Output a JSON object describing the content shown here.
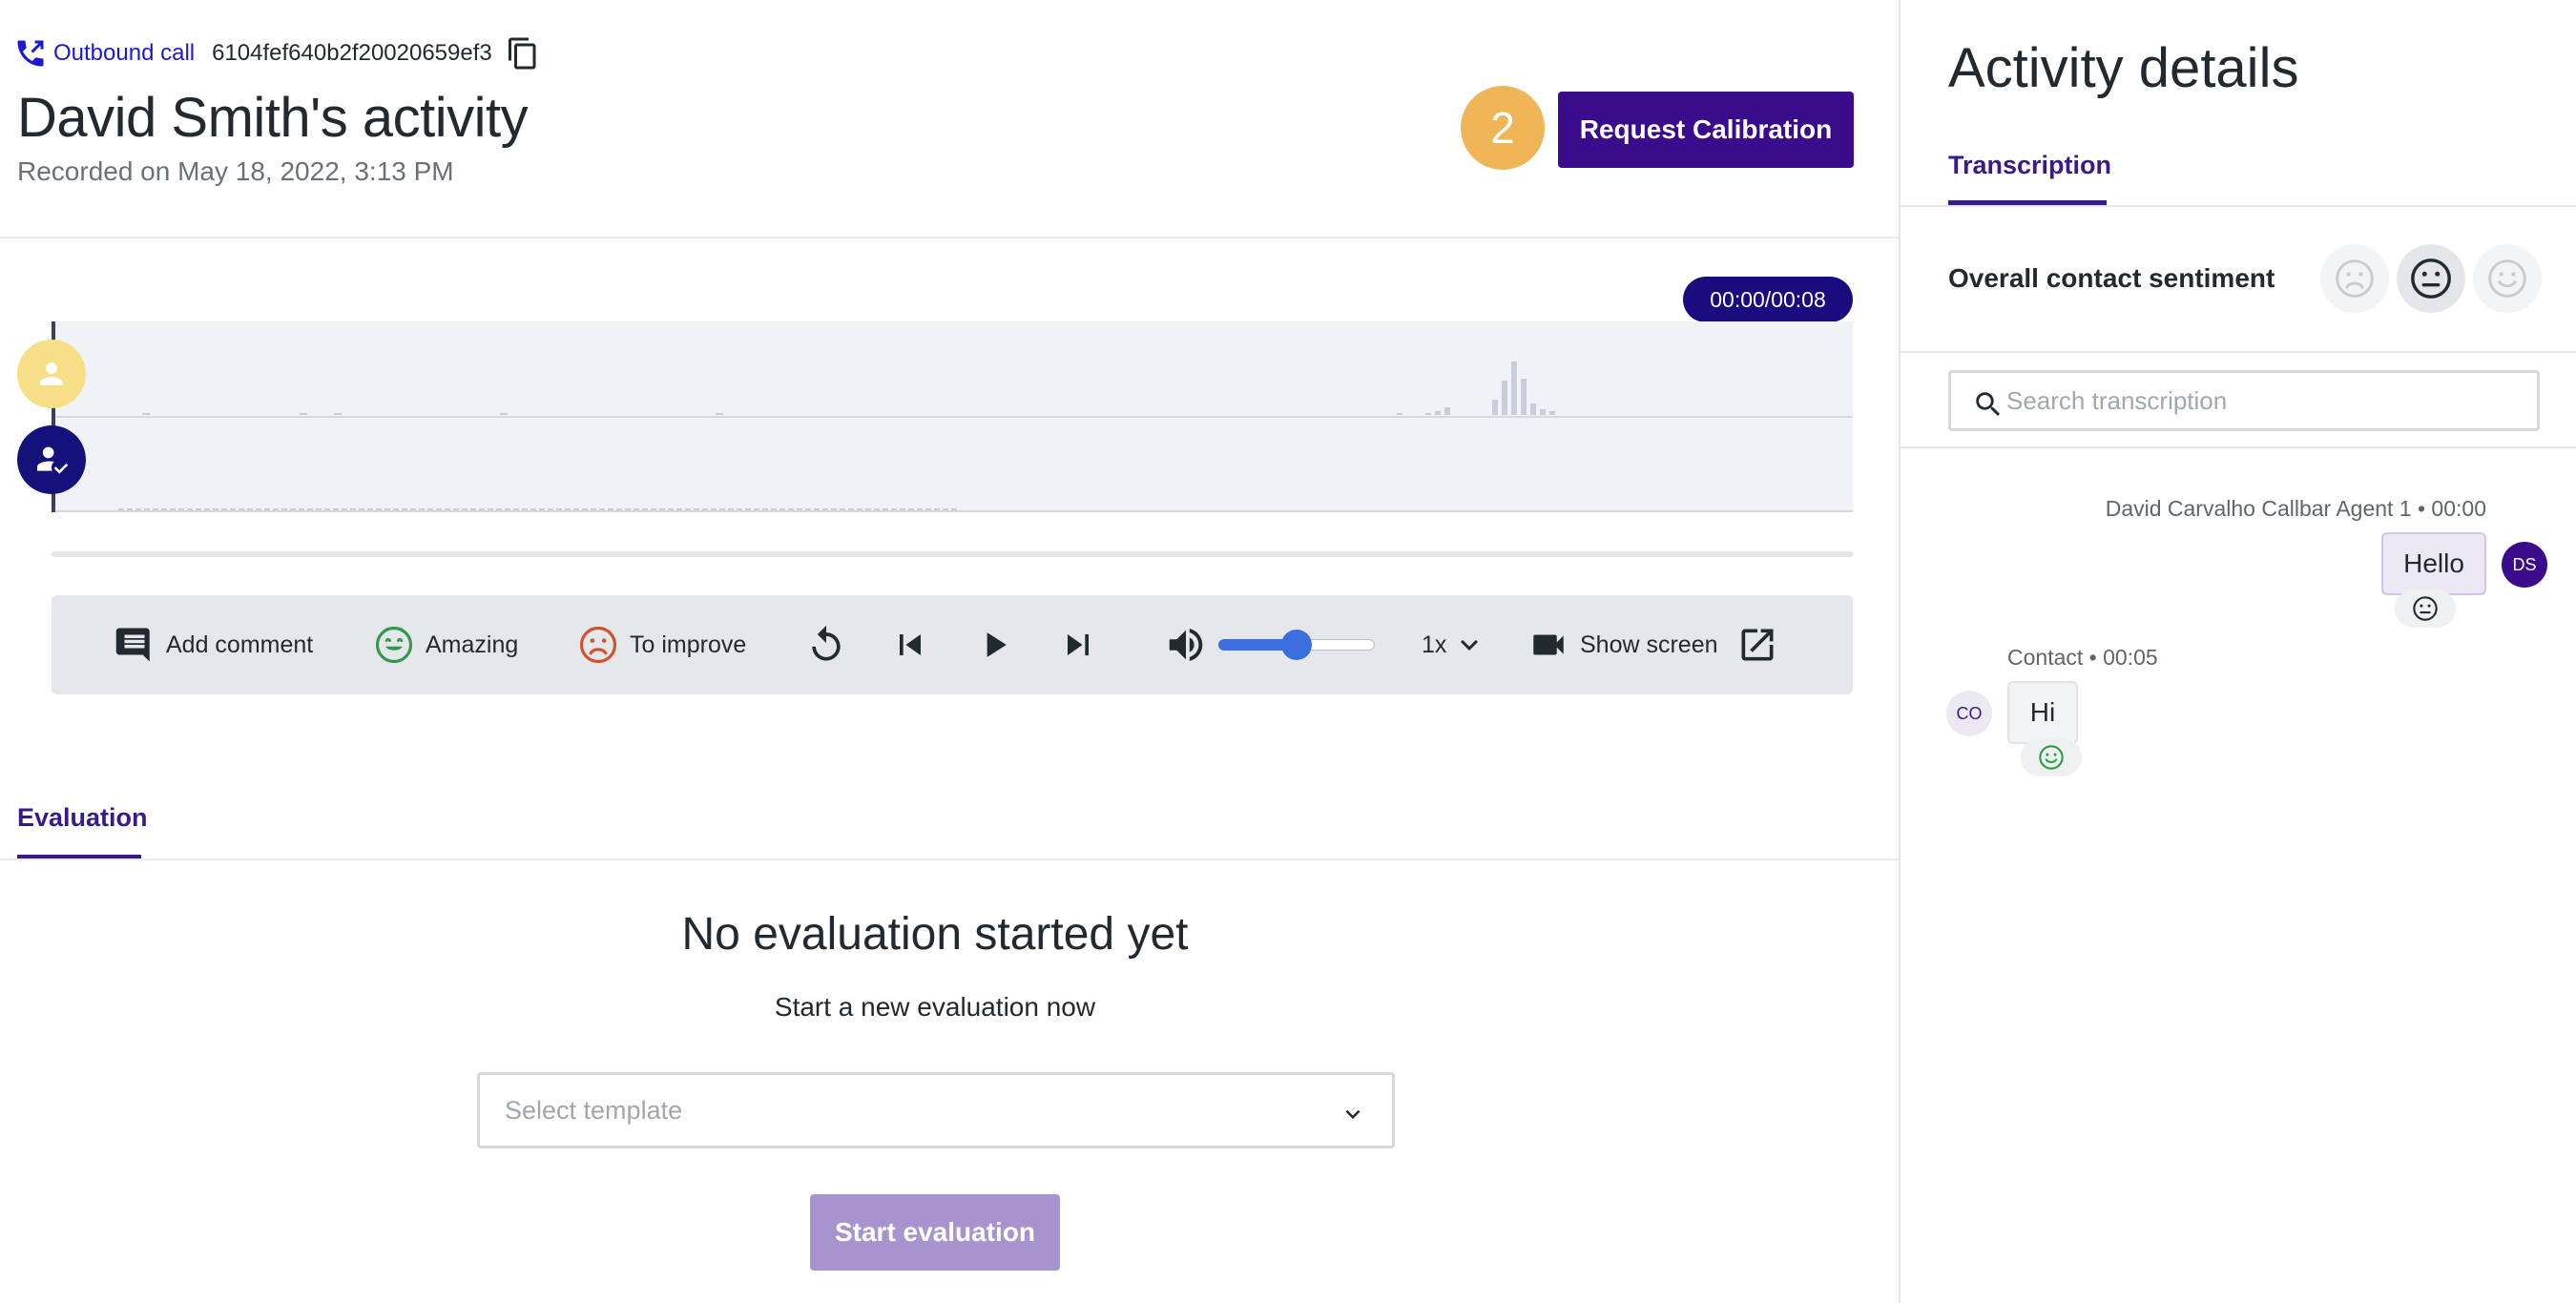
{
  "header": {
    "call_type": "Outbound call",
    "call_id": "6104fef640b2f20020659ef3",
    "title": "David Smith's activity",
    "recorded": "Recorded on May 18, 2022, 3:13 PM",
    "badge_count": "2",
    "request_button": "Request Calibration"
  },
  "player": {
    "time": "00:00/00:08",
    "volume_percent": 50,
    "toolbar": {
      "add_comment": "Add comment",
      "amazing": "Amazing",
      "to_improve": "To improve",
      "speed": "1x",
      "show_screen": "Show screen"
    },
    "icons": [
      "comment-icon",
      "smile-icon",
      "sad-icon",
      "replay-icon",
      "skip-previous-icon",
      "play-icon",
      "skip-next-icon",
      "volume-icon",
      "chevron-down-icon",
      "videocam-icon",
      "open-external-icon"
    ]
  },
  "evaluation": {
    "tab": "Evaluation",
    "empty_title": "No evaluation started yet",
    "empty_subtitle": "Start a new evaluation now",
    "template_placeholder": "Select template",
    "start_button": "Start evaluation"
  },
  "details": {
    "title": "Activity details",
    "tab": "Transcription",
    "sentiment_label": "Overall contact sentiment",
    "sentiment_selected": "neutral",
    "search_placeholder": "Search transcription",
    "messages": [
      {
        "speaker": "David Carvalho Callbar Agent 1",
        "time": "00:00",
        "meta": "David Carvalho Callbar Agent 1 • 00:00",
        "text": "Hello",
        "initials": "DS",
        "reaction": "neutral"
      },
      {
        "speaker": "Contact",
        "time": "00:05",
        "meta": "Contact • 00:05",
        "text": "Hi",
        "initials": "CO",
        "reaction": "happy"
      }
    ]
  },
  "colors": {
    "primary": "#3a0b8a",
    "badge": "#f0b556",
    "time_pill": "#1a0b7e",
    "start_button_disabled": "#a993cf",
    "slider": "#3b6fe0",
    "amazing": "#2e9a4a",
    "to_improve": "#d2502a",
    "link": "#1a1ad6"
  }
}
